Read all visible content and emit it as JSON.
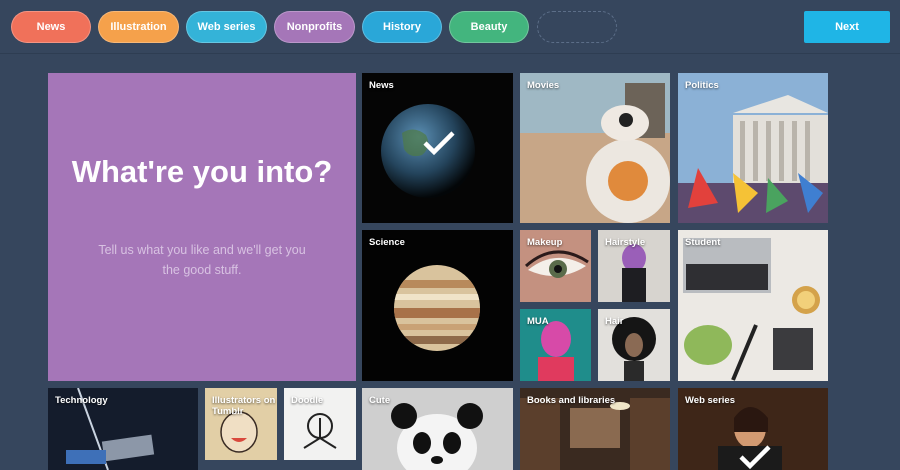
{
  "top_bar": {
    "tags": [
      {
        "label": "News",
        "color": "#f0715a"
      },
      {
        "label": "Illustration",
        "color": "#f5a14b"
      },
      {
        "label": "Web series",
        "color": "#34b3d8"
      },
      {
        "label": "Nonprofits",
        "color": "#a576b8"
      },
      {
        "label": "History",
        "color": "#2aa7d8"
      },
      {
        "label": "Beauty",
        "color": "#43b57e"
      }
    ],
    "next_label": "Next"
  },
  "hero": {
    "title": "What're you into?",
    "subtitle": "Tell us what you like and we'll get you the good stuff."
  },
  "tiles": {
    "news": "News",
    "movies": "Movies",
    "politics": "Politics",
    "science": "Science",
    "makeup": "Makeup",
    "hairstyle": "Hairstyle",
    "student": "Student",
    "mua": "MUA",
    "hair": "Hair",
    "technology": "Technology",
    "illustrators": "Illustrators on Tumblr",
    "doodle": "Doodle",
    "cute": "Cute",
    "books": "Books and libraries",
    "web_series": "Web series"
  },
  "selected": [
    "News",
    "Web series"
  ],
  "colors": {
    "background": "#36465d",
    "accent": "#1fb5e6",
    "hero": "#a576b8"
  }
}
